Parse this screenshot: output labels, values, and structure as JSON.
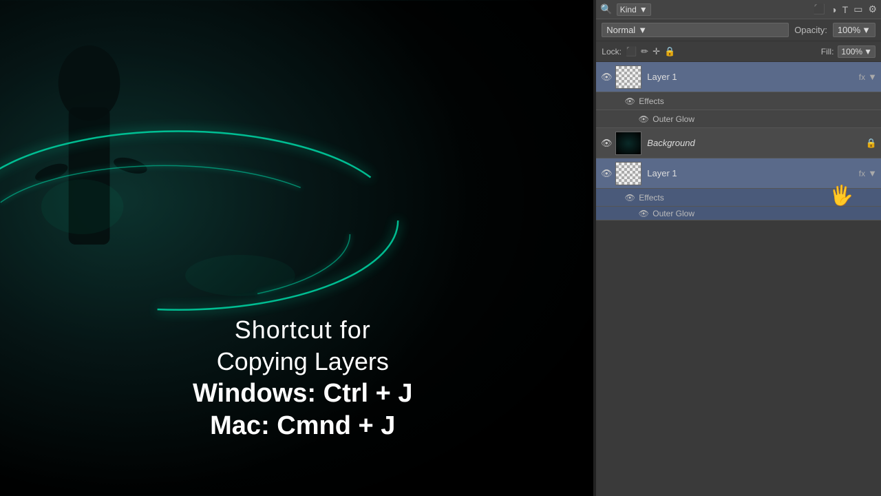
{
  "canvas": {
    "overlay_text": {
      "line1": "Shortcut for",
      "line2": "Copying Layers",
      "line3": "Windows: Ctrl + J",
      "line4": "Mac: Cmnd + J"
    }
  },
  "layers_panel": {
    "top_bar": {
      "kind_label": "Kind",
      "kind_dropdown_arrow": "▼"
    },
    "blend_mode": {
      "value": "Normal",
      "arrow": "▼",
      "opacity_label": "Opacity:",
      "opacity_value": "100%",
      "opacity_arrow": "▼"
    },
    "lock": {
      "label": "Lock:",
      "fill_label": "Fill:",
      "fill_value": "100%",
      "fill_arrow": "▼"
    },
    "layers": [
      {
        "name": "Layer 1",
        "type": "normal",
        "selected": true,
        "has_effects": true,
        "has_lock": false
      },
      {
        "name": "Background",
        "type": "bg",
        "selected": false,
        "has_effects": false,
        "has_lock": true
      }
    ],
    "effects_label": "Effects",
    "outer_glow_label": "Outer Glow",
    "fx_label": "fx"
  }
}
